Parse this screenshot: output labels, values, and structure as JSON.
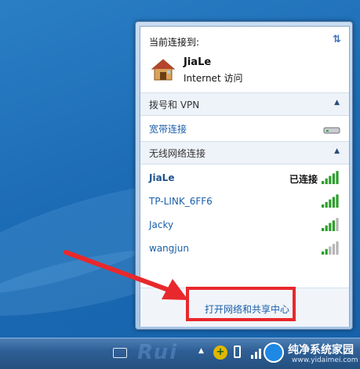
{
  "flyout": {
    "current_label": "当前连接到:",
    "connection": {
      "name": "JiaLe",
      "access": "Internet 访问",
      "icon": "house-icon"
    },
    "dialup": {
      "header": "拨号和 VPN",
      "items": [
        {
          "name": "宽带连接",
          "icon": "modem-icon"
        }
      ]
    },
    "wireless": {
      "header": "无线网络连接",
      "networks": [
        {
          "ssid": "JiaLe",
          "status": "已连接",
          "signal_bars": 5
        },
        {
          "ssid": "TP-LINK_6FF6",
          "status": "",
          "signal_bars": 5
        },
        {
          "ssid": "Jacky",
          "status": "",
          "signal_bars": 4
        },
        {
          "ssid": "wangjun",
          "status": "",
          "signal_bars": 2
        }
      ]
    },
    "footer": {
      "open_center": "打开网络和共享中心"
    }
  },
  "taskbar": {
    "watermark": "Rui",
    "brand_name": "纯净系统家园",
    "brand_url": "www.yidaimei.com"
  },
  "colors": {
    "highlight": "#e8282c",
    "link": "#1a5fa8",
    "signal_on": "#2e9e2e",
    "signal_off": "#b5b5b5"
  }
}
